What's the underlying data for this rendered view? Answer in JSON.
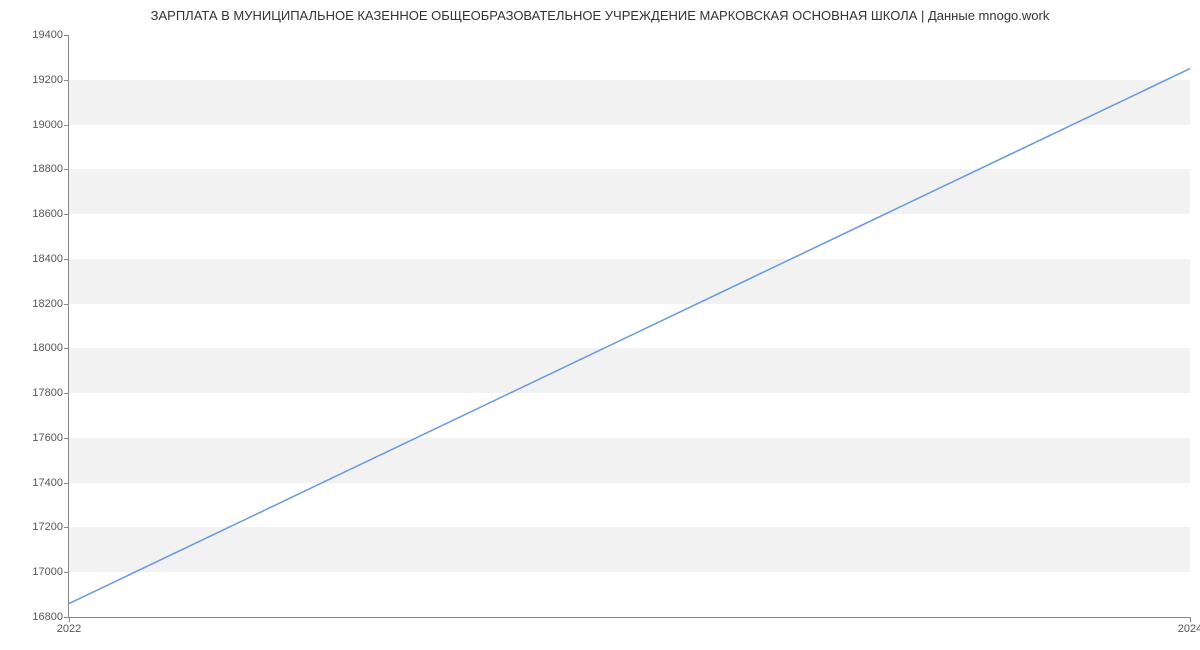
{
  "chart_data": {
    "type": "line",
    "title": "ЗАРПЛАТА В МУНИЦИПАЛЬНОЕ КАЗЕННОЕ ОБЩЕОБРАЗОВАТЕЛЬНОЕ УЧРЕЖДЕНИЕ МАРКОВСКАЯ ОСНОВНАЯ ШКОЛА | Данные mnogo.work",
    "x": [
      2022,
      2024
    ],
    "values": [
      16860,
      19250
    ],
    "xlabel": "",
    "ylabel": "",
    "x_ticks": [
      2022,
      2024
    ],
    "y_ticks": [
      16800,
      17000,
      17200,
      17400,
      17600,
      17800,
      18000,
      18200,
      18400,
      18600,
      18800,
      19000,
      19200,
      19400
    ],
    "ylim": [
      16800,
      19400
    ],
    "xlim": [
      2022,
      2024
    ],
    "grid": true,
    "line_color": "#6699dd"
  }
}
